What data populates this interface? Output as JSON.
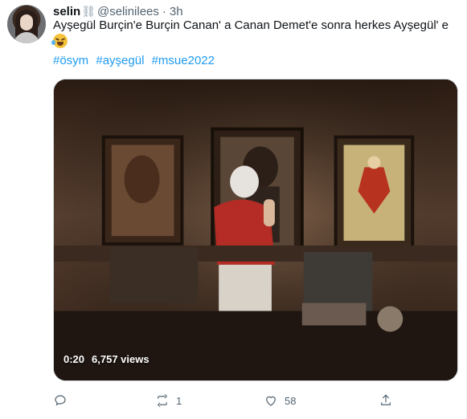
{
  "tweet": {
    "author_name": "selin",
    "author_handle": "@selinilees",
    "separator": "·",
    "time": "3h",
    "text": "Ayşegül Burçin'e Burçin Canan' a Canan Demet'e sonra herkes Ayşegül' e",
    "emoji": "face-with-tears-of-joy",
    "hashtags": [
      "#ösym",
      "#ayşegül",
      "#msue2022"
    ]
  },
  "media": {
    "duration": "0:20",
    "views": "6,757 views"
  },
  "actions": {
    "reply_count": "",
    "retweet_count": "1",
    "like_count": "58",
    "share_count": ""
  },
  "colors": {
    "text": "#0f1419",
    "secondary": "#536471",
    "link": "#1d9bf0"
  },
  "icons": {
    "reply": "reply-icon",
    "retweet": "retweet-icon",
    "like": "heart-icon",
    "share": "share-icon",
    "chain": "link-chain-icon"
  }
}
